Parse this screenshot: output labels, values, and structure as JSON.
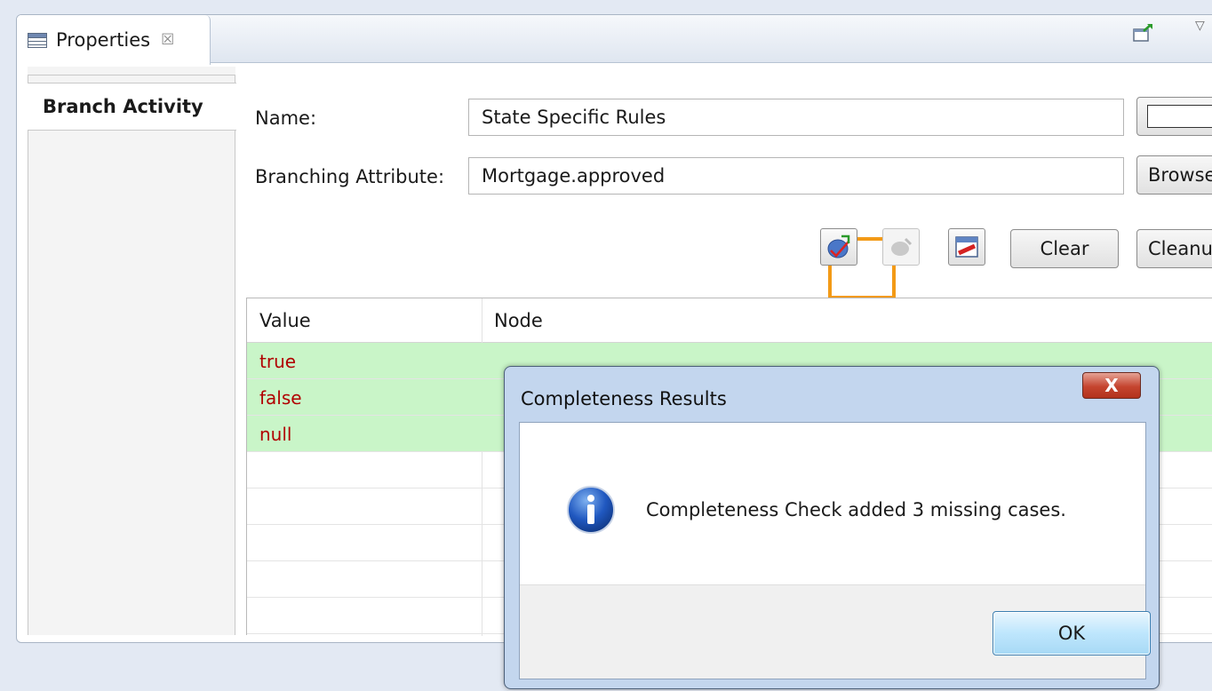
{
  "view": {
    "tab_label": "Properties",
    "tab_close": "☒"
  },
  "sections": {
    "active_label": "Branch Activity"
  },
  "form": {
    "name_label": "Name:",
    "name_value": "State Specific Rules",
    "attr_label": "Branching Attribute:",
    "attr_value": "Mortgage.approved",
    "browse_label": "Browse"
  },
  "toolbar": {
    "icons": [
      "completeness-check-icon",
      "disabled-rule-icon",
      "table-edit-icon"
    ],
    "clear_label": "Clear",
    "cleanup_label": "Cleanu"
  },
  "table": {
    "columns": [
      "Value",
      "Node"
    ],
    "rows": [
      {
        "value": "true"
      },
      {
        "value": "false"
      },
      {
        "value": "null"
      }
    ]
  },
  "dialog": {
    "title": "Completeness Results",
    "close_label": "X",
    "message": "Completeness Check added 3 missing cases.",
    "ok_label": "OK"
  },
  "colors": {
    "highlight": "#f39a16",
    "row_green": "#c9f5c8",
    "value_text": "#b10000"
  }
}
